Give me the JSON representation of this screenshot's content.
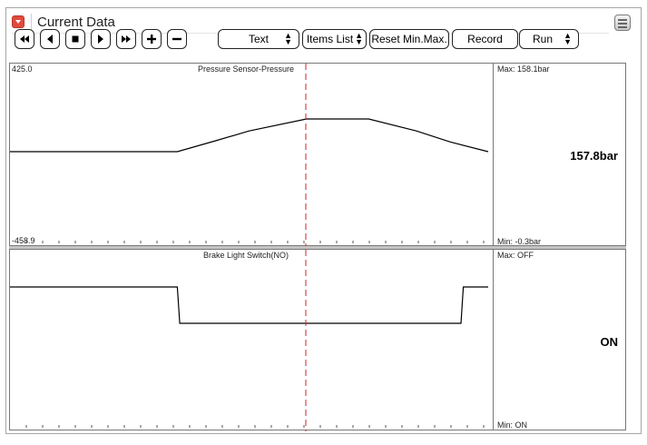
{
  "window": {
    "title": "Current Data"
  },
  "toolbar": {
    "text_select": "Text",
    "items_list": "Items List",
    "reset": "Reset Min.Max.",
    "record": "Record",
    "run_select": "Run"
  },
  "graphs": [
    {
      "label": "Pressure Sensor-Pressure",
      "scale_max": "425.0",
      "scale_min": "-458.9",
      "max": "Max: 158.1bar",
      "min": "Min:  -0.3bar",
      "value": "157.8bar",
      "trace": [
        [
          0,
          0
        ],
        [
          35,
          0
        ],
        [
          43,
          20
        ],
        [
          50,
          38
        ],
        [
          62,
          60
        ],
        [
          75,
          60
        ],
        [
          85,
          38
        ],
        [
          92,
          18
        ],
        [
          100,
          0
        ]
      ]
    },
    {
      "label": "Brake Light Switch(NO)",
      "max": "Max: OFF",
      "min": "Min:  ON",
      "value": "ON",
      "trace": [
        [
          0,
          1
        ],
        [
          35,
          1
        ],
        [
          35.5,
          0
        ],
        [
          94.3,
          0
        ],
        [
          94.8,
          1
        ],
        [
          100,
          1
        ]
      ]
    }
  ],
  "colors": {
    "cursor": "#d22222",
    "trace": "#000000",
    "collapse_button": "#e04a3c"
  }
}
